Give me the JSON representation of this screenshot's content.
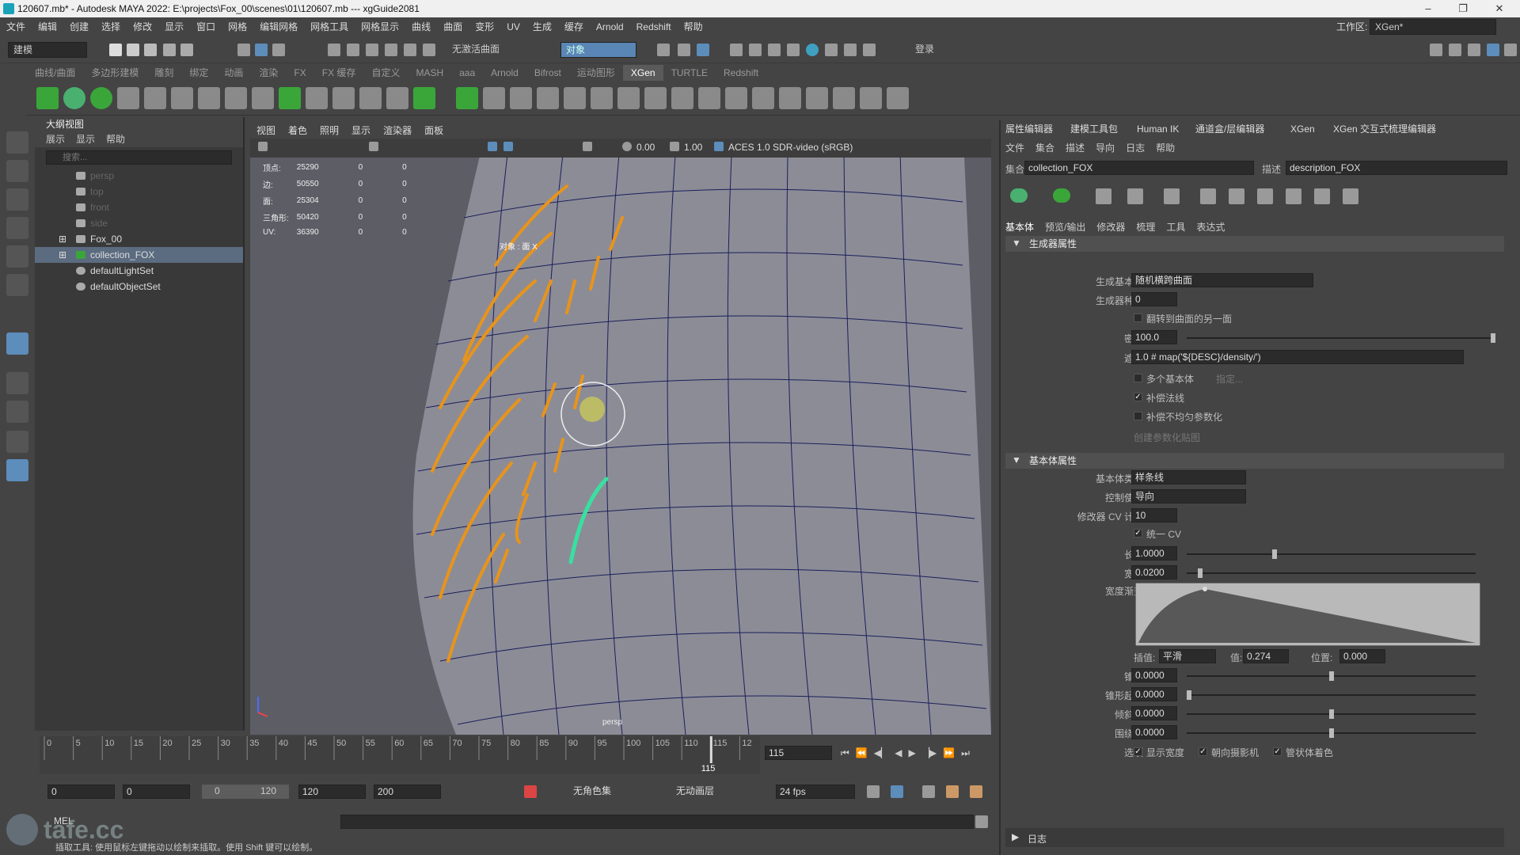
{
  "title_bar": {
    "title": "120607.mb* - Autodesk MAYA 2022: E:\\projects\\Fox_00\\scenes\\01\\120607.mb   ---   xgGuide2081",
    "minimize": "–",
    "maximize": "❐",
    "close": "✕"
  },
  "menu": [
    "文件",
    "编辑",
    "创建",
    "选择",
    "修改",
    "显示",
    "窗口",
    "网格",
    "编辑网格",
    "网格工具",
    "网格显示",
    "曲线",
    "曲面",
    "变形",
    "UV",
    "生成",
    "缓存",
    "Arnold",
    "Redshift",
    "帮助"
  ],
  "workspace": {
    "label": "工作区:",
    "value": "XGen*"
  },
  "status_line": {
    "mode": "建模",
    "live_surface": "无激活曲面",
    "object_field": "对象",
    "login": "登录"
  },
  "shelf_tabs": [
    "曲线/曲面",
    "多边形建模",
    "雕刻",
    "绑定",
    "动画",
    "渲染",
    "FX",
    "FX 缓存",
    "自定义",
    "MASH",
    "aaa",
    "Arnold",
    "Bifrost",
    "运动图形",
    "XGen",
    "TURTLE",
    "Redshift"
  ],
  "shelf_active": "XGen",
  "outliner": {
    "title": "大纲视图",
    "menu": [
      "展示",
      "显示",
      "帮助"
    ],
    "search_placeholder": "搜索...",
    "items": [
      {
        "label": "persp",
        "dim": true
      },
      {
        "label": "top",
        "dim": true
      },
      {
        "label": "front",
        "dim": true
      },
      {
        "label": "side",
        "dim": true
      },
      {
        "label": "Fox_00",
        "dim": false
      },
      {
        "label": "collection_FOX",
        "dim": false,
        "selected": true
      },
      {
        "label": "defaultLightSet",
        "dim": false
      },
      {
        "label": "defaultObjectSet",
        "dim": false
      }
    ]
  },
  "viewport": {
    "menu": [
      "视图",
      "着色",
      "照明",
      "显示",
      "渲染器",
      "面板"
    ],
    "exposure": "0.00",
    "gamma": "1.00",
    "colorspace": "ACES 1.0 SDR-video (sRGB)",
    "camera_label": "persp",
    "object_label": "对象 : 面 X",
    "hud": [
      {
        "label": "顶点:",
        "v1": "25290",
        "v2": "0",
        "v3": "0"
      },
      {
        "label": "边:",
        "v1": "50550",
        "v2": "0",
        "v3": "0"
      },
      {
        "label": "面:",
        "v1": "25304",
        "v2": "0",
        "v3": "0"
      },
      {
        "label": "三角形:",
        "v1": "50420",
        "v2": "0",
        "v3": "0"
      },
      {
        "label": "UV:",
        "v1": "36390",
        "v2": "0",
        "v3": "0"
      }
    ]
  },
  "right_panel": {
    "tabs": [
      "属性编辑器",
      "建模工具包",
      "Human IK",
      "通道盒/层编辑器",
      "XGen",
      "XGen 交互式梳理编辑器"
    ],
    "menu": [
      "文件",
      "集合",
      "描述",
      "导向",
      "日志",
      "帮助"
    ],
    "collection_label": "集合",
    "collection_value": "collection_FOX",
    "description_label": "描述",
    "description_value": "description_FOX",
    "subtabs": [
      "基本体",
      "预览/输出",
      "修改器",
      "梳理",
      "工具",
      "表达式"
    ],
    "generator_section": "生成器属性",
    "generator": {
      "primitive_label": "生成基本体",
      "primitive_value": "随机横跨曲面",
      "seed_label": "生成器种子",
      "seed_value": "0",
      "flip_label": "翻转到曲面的另一面",
      "density_label": "密度",
      "density_value": "100.0",
      "density_level": 1.0,
      "mask_label": "遮罩",
      "mask_value": "1.0 # map('${DESC}/density/')",
      "multi_label": "多个基本体",
      "multi_hint": "指定...",
      "comp_normals_label": "补偿法线",
      "comp_uneven_label": "补偿不均匀参数化",
      "create_map": "创建参数化贴图"
    },
    "primitive_section": "基本体属性",
    "primitive": {
      "type_label": "基本体类型",
      "type_value": "样条线",
      "control_label": "控制使用",
      "control_value": "导向",
      "cv_label": "修改器 CV 计数",
      "cv_value": "10",
      "unify_cv": "统一 CV",
      "length_label": "长度",
      "length_value": "1.0000",
      "length_level": 0.3,
      "width_label": "宽度",
      "width_value": "0.0200",
      "width_level": 0.04,
      "ramp_label": "宽度渐变",
      "interp_label": "插值:",
      "interp_value": "平滑",
      "value_label": "值:",
      "value_value": "0.274",
      "pos_label": "位置:",
      "pos_value": "0.000",
      "taper_label": "锥化",
      "taper_value": "0.0000",
      "taper_level": 0.5,
      "taper_start_label": "锥形起点",
      "taper_start_value": "0.0000",
      "taper_start_level": 0.0,
      "tilt_label": "倾斜 N",
      "tilt_value": "0.0000",
      "tilt_level": 0.5,
      "bend_label": "围绕 N",
      "bend_value": "0.0000",
      "bend_level": 0.5,
      "options_label": "选项",
      "opt1": "显示宽度",
      "opt2": "朝向摄影机",
      "opt3": "管状体着色"
    },
    "log_label": "日志"
  },
  "timeline": {
    "ticks": [
      "0",
      "5",
      "10",
      "15",
      "20",
      "25",
      "30",
      "35",
      "40",
      "45",
      "50",
      "55",
      "60",
      "65",
      "70",
      "75",
      "80",
      "85",
      "90",
      "95",
      "100",
      "105",
      "110",
      "115",
      "12"
    ],
    "current_frame": "115",
    "frame_field": "115"
  },
  "range": {
    "start": "0",
    "anim_start": "0",
    "slider_start": "0",
    "slider_end": "120",
    "end": "120",
    "anim_end": "200",
    "char_set": "无角色集",
    "anim_layer": "无动画层",
    "fps": "24 fps"
  },
  "cmdline": {
    "label": "MEL"
  },
  "help_line": "插取工具: 使用鼠标左键拖动以绘制来插取。使用 Shift 键可以绘制。",
  "watermark": "tafe.cc",
  "colors": {
    "guide_orange": "#e8941a",
    "guide_selected": "#38e0a0",
    "mesh_wire": "#1a1f5a",
    "mesh_fill": "#8a8a94"
  }
}
